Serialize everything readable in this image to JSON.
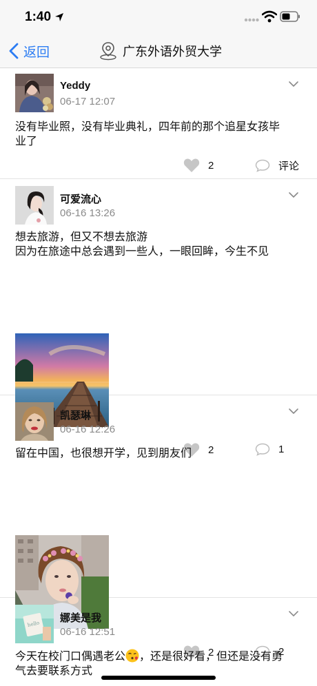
{
  "status_bar": {
    "time": "1:40"
  },
  "nav": {
    "back_label": "返回",
    "title": "广东外语外贸大学"
  },
  "posts": [
    {
      "username": "Yeddy",
      "time": "06-17 12:07",
      "text": "没有毕业照，没有毕业典礼，四年前的那个追星女孩毕\n业了",
      "likes": "2",
      "comments": "评论",
      "has_image": false
    },
    {
      "username": "可爱流心",
      "time": "06-16 13:26",
      "text": "想去旅游，但又不想去旅游\n因为在旅途中总会遇到一些人，一眼回眸，今生不见",
      "likes": "2",
      "comments": "1",
      "has_image": true,
      "image": "pier-sunset-photo"
    },
    {
      "username": "凯瑟琳",
      "time": "06-16 12:26",
      "text": "留在中国，也很想开学，见到朋友们",
      "likes": "2",
      "comments": "2",
      "has_image": true,
      "image": "girl-flower-crown-photo"
    },
    {
      "username": "娜美是我",
      "time": "06-16 12:51",
      "text_before_emoji": "今天在校门口偶遇老公",
      "emoji": "kissing-face-emoji",
      "text_after_emoji": "，还是很好看，但还是没有勇",
      "text_line2": "气去要联系方式"
    }
  ],
  "colors": {
    "accent": "#2b7cf3",
    "meta_gray": "#8a8a8a",
    "icon_gray": "#c6c6c6",
    "divider": "#e3e3e3"
  }
}
